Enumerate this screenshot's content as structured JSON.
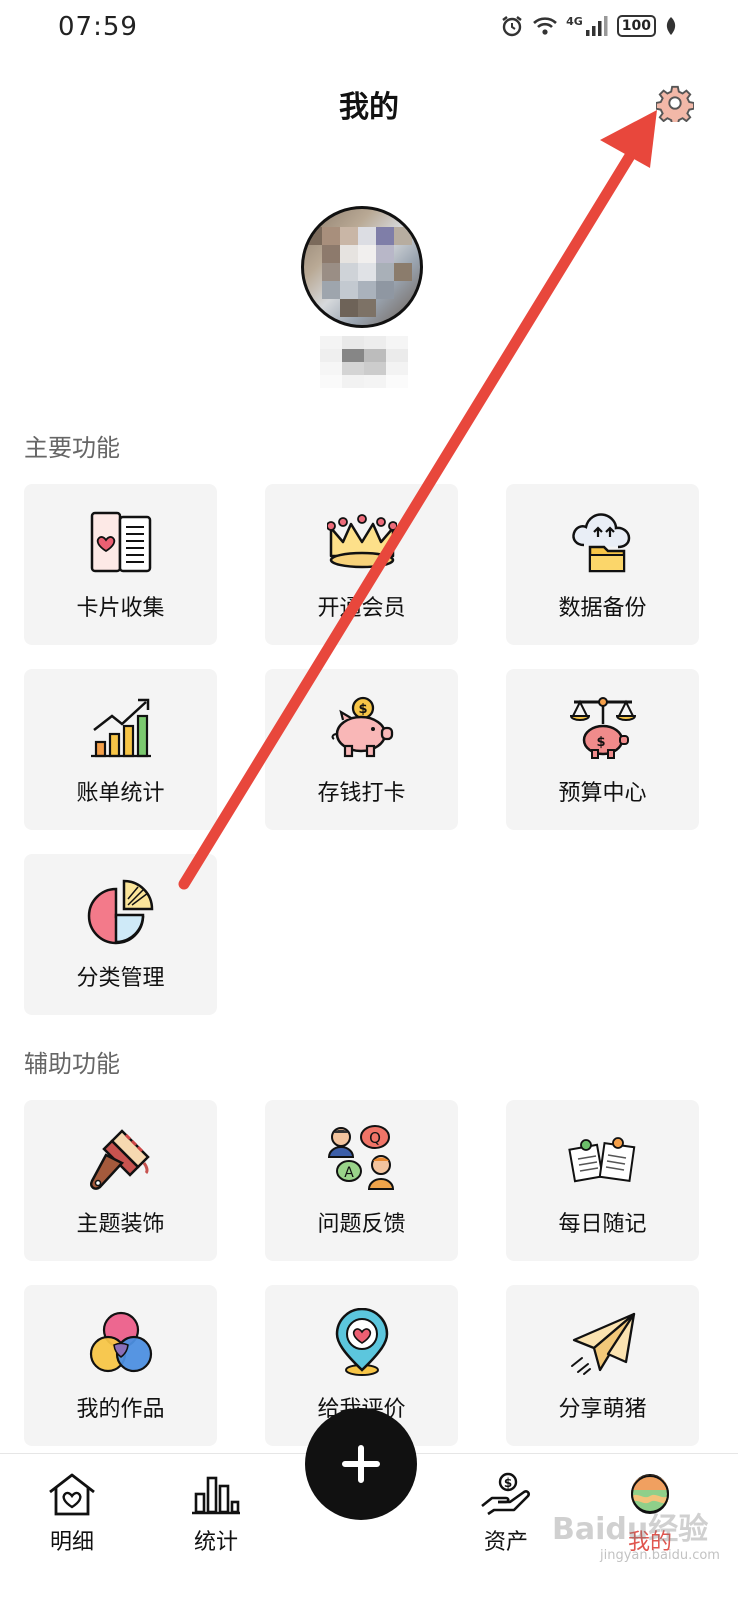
{
  "status_bar": {
    "time": "07:59",
    "network": "4G",
    "battery": "100"
  },
  "header": {
    "title": "我的"
  },
  "sections": {
    "main": {
      "title": "主要功能",
      "items": [
        {
          "label": "卡片收集",
          "icon": "card-collection-icon"
        },
        {
          "label": "开通会员",
          "icon": "crown-icon"
        },
        {
          "label": "数据备份",
          "icon": "cloud-backup-icon"
        },
        {
          "label": "账单统计",
          "icon": "bar-chart-icon"
        },
        {
          "label": "存钱打卡",
          "icon": "piggy-bank-icon"
        },
        {
          "label": "预算中心",
          "icon": "budget-scale-icon"
        },
        {
          "label": "分类管理",
          "icon": "pie-chart-icon"
        }
      ]
    },
    "aux": {
      "title": "辅助功能",
      "items": [
        {
          "label": "主题装饰",
          "icon": "paint-brush-icon"
        },
        {
          "label": "问题反馈",
          "icon": "qa-feedback-icon"
        },
        {
          "label": "每日随记",
          "icon": "notes-icon"
        },
        {
          "label": "我的作品",
          "icon": "color-circles-icon"
        },
        {
          "label": "给我评价",
          "icon": "heart-pin-icon"
        },
        {
          "label": "分享萌猪",
          "icon": "paper-plane-icon"
        }
      ]
    }
  },
  "tabs": [
    {
      "label": "明细",
      "icon": "home-heart-icon"
    },
    {
      "label": "统计",
      "icon": "bar-stats-icon"
    },
    {
      "label": "资产",
      "icon": "money-hand-icon"
    },
    {
      "label": "我的",
      "icon": "avatar-tab-icon",
      "active": true
    }
  ],
  "fab": {
    "icon": "plus-icon"
  },
  "watermark": {
    "text": "Baidu经验",
    "sub": "jingyan.baidu.com"
  },
  "colors": {
    "accent": "#e0564f",
    "annotation_arrow": "#e8473c",
    "card_bg": "#f4f4f4"
  }
}
